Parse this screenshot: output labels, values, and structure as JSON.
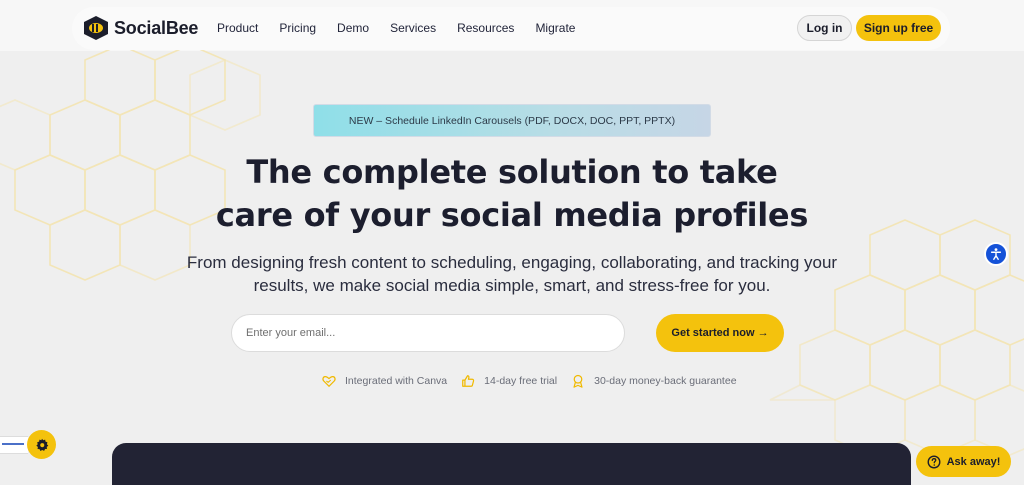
{
  "brand": {
    "name": "SocialBee"
  },
  "nav": {
    "links": [
      "Product",
      "Pricing",
      "Demo",
      "Services",
      "Resources",
      "Migrate"
    ],
    "login_label": "Log in",
    "signup_label": "Sign up free"
  },
  "announcement": {
    "text": "NEW – Schedule LinkedIn Carousels (PDF, DOCX, DOC, PPT, PPTX)"
  },
  "hero": {
    "title_line1": "The complete solution to take",
    "title_line2": "care of your social media profiles",
    "subtitle": "From designing fresh content to scheduling, engaging, collaborating, and tracking your results, we make social media simple, smart, and stress-free for you.",
    "email_placeholder": "Enter your email...",
    "cta_label": "Get started now →"
  },
  "features": [
    {
      "icon": "heart-handshake-icon",
      "label": "Integrated with Canva"
    },
    {
      "icon": "thumbs-up-icon",
      "label": "14-day free trial"
    },
    {
      "icon": "award-badge-icon",
      "label": "30-day money-back guarantee"
    }
  ],
  "widgets": {
    "ask_label": "Ask away!",
    "accessibility_icon": "accessibility-icon",
    "settings_icon": "gear-icon"
  },
  "colors": {
    "accent": "#f4c20d",
    "dark": "#1c1e2e",
    "background": "#efefef",
    "announcement": "#8fdfe8",
    "accessibility": "#1552d8"
  }
}
